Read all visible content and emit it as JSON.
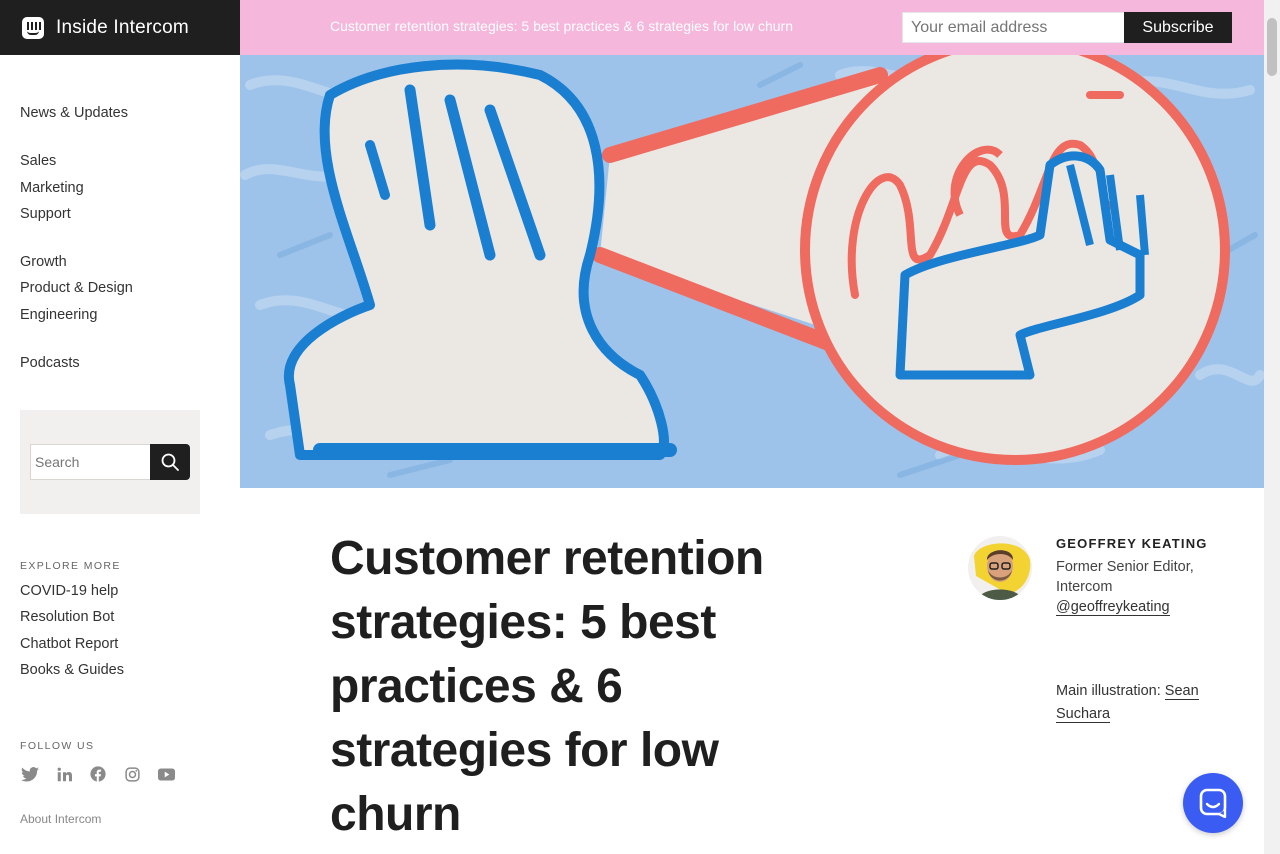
{
  "brand": {
    "name": "Inside Intercom"
  },
  "banner": {
    "title": "Customer retention strategies: 5 best practices & 6 strategies for low churn",
    "email_placeholder": "Your email address",
    "subscribe_label": "Subscribe",
    "background": "#f6b7dc"
  },
  "sidebar": {
    "groups": [
      [
        {
          "label": "News & Updates"
        }
      ],
      [
        {
          "label": "Sales"
        },
        {
          "label": "Marketing"
        },
        {
          "label": "Support"
        }
      ],
      [
        {
          "label": "Growth"
        },
        {
          "label": "Product & Design"
        },
        {
          "label": "Engineering"
        }
      ],
      [
        {
          "label": "Podcasts"
        }
      ]
    ],
    "search_placeholder": "Search",
    "explore_label": "EXPLORE MORE",
    "explore_items": [
      {
        "label": "COVID-19 help"
      },
      {
        "label": "Resolution Bot"
      },
      {
        "label": "Chatbot Report"
      },
      {
        "label": "Books & Guides"
      }
    ],
    "follow_label": "FOLLOW US",
    "social_icons": [
      "twitter-icon",
      "linkedin-icon",
      "facebook-icon",
      "instagram-icon",
      "youtube-icon"
    ],
    "about_label": "About Intercom"
  },
  "article": {
    "title": "Customer retention strategies: 5 best practices & 6 strategies for low churn"
  },
  "author": {
    "name": "GEOFFREY KEATING",
    "role": "Former Senior Editor, Intercom",
    "handle": "@geoffreykeating"
  },
  "illustration": {
    "prefix": "Main illustration: ",
    "artist": "Sean Suchara"
  },
  "colors": {
    "dark": "#1f1f1f",
    "hero_blue": "#9ec3ea",
    "stroke_blue": "#1a7fd0",
    "stroke_red": "#ef6a5f",
    "messenger": "#3a5cf2"
  }
}
